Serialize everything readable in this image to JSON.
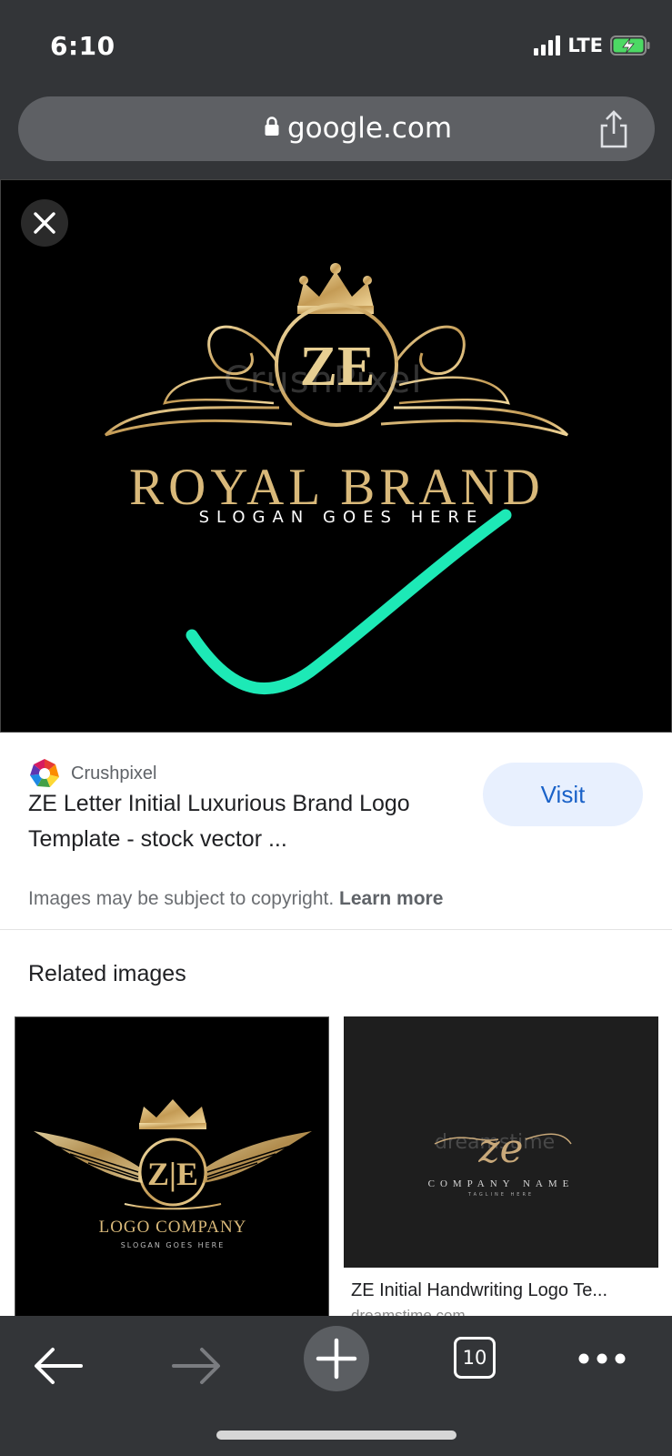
{
  "status_bar": {
    "time": "6:10",
    "network": "LTE",
    "signal_bars": 4,
    "battery_state": "charging"
  },
  "browser": {
    "url": "google.com",
    "lock_icon": "lock-icon",
    "share_icon": "share-icon"
  },
  "preview": {
    "close_icon": "close-icon",
    "logo_initials": "ZE",
    "logo_title": "ROYAL BRAND",
    "logo_slogan": "SLOGAN GOES HERE",
    "watermark": "CrushPixel",
    "annotation_color": "#1de9b6",
    "gold_color": "#d9b97a"
  },
  "result": {
    "source_name": "Crushpixel",
    "title": "ZE Letter Initial Luxurious Brand Logo Template - stock vector ...",
    "visit_label": "Visit",
    "copyright_text": "Images may be subject to copyright.",
    "learn_more": "Learn more"
  },
  "related": {
    "heading": "Related images",
    "items": [
      {
        "initials": "Z|E",
        "company": "LOGO COMPANY",
        "slogan": "SLOGAN GOES HERE"
      },
      {
        "script": "ze",
        "company": "COMPANY NAME",
        "tagline": "TAGLINE HERE",
        "watermark": "dreamstime",
        "caption": "ZE Initial Handwriting Logo Te...",
        "source": "dreamstime.com"
      }
    ]
  },
  "toolbar": {
    "back_icon": "back-arrow-icon",
    "forward_icon": "forward-arrow-icon",
    "new_tab_icon": "plus-icon",
    "tab_count": "10",
    "more_icon": "more-dots-icon"
  }
}
